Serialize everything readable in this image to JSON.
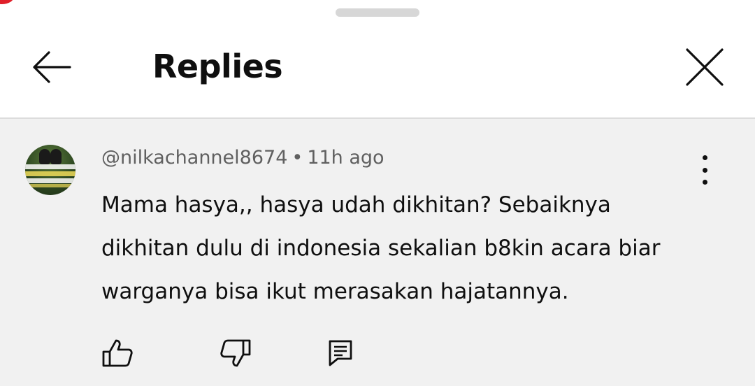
{
  "header": {
    "title": "Replies",
    "back_icon": "arrow-left-icon",
    "close_icon": "close-icon"
  },
  "comment": {
    "author": "@nilkachannel8674",
    "separator": "•",
    "time": "11h ago",
    "text": "Mama hasya,, hasya udah dikhitan? Sebaiknya dikhitan dulu di indonesia sekalian b8kin acara biar warganya bisa ikut merasakan hajatannya.",
    "avatar_icon": "avatar",
    "more_icon": "more-vert-icon"
  },
  "actions": {
    "like_icon": "thumbs-up-icon",
    "dislike_icon": "thumbs-down-icon",
    "reply_icon": "comment-icon"
  },
  "colors": {
    "accent_red": "#e0202a",
    "comment_bg": "#f1f1f1",
    "meta_gray": "#606060",
    "text_dark": "#0f0f0f"
  }
}
